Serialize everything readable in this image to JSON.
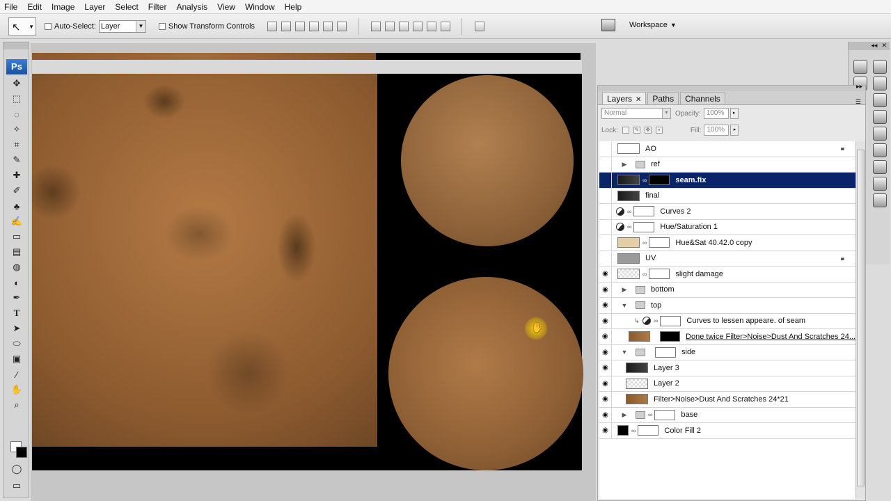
{
  "menu": [
    "File",
    "Edit",
    "Image",
    "Layer",
    "Select",
    "Filter",
    "Analysis",
    "View",
    "Window",
    "Help"
  ],
  "options": {
    "auto_select_label": "Auto-Select:",
    "auto_select_value": "Layer",
    "show_transform_label": "Show Transform Controls",
    "workspace_label": "Workspace"
  },
  "tools": {
    "logo": "Ps"
  },
  "layers_panel": {
    "tabs": [
      "Layers",
      "Paths",
      "Channels"
    ],
    "blend_mode": "Normal",
    "opacity_label": "Opacity:",
    "opacity_value": "100%",
    "lock_label": "Lock:",
    "fill_label": "Fill:",
    "fill_value": "100%",
    "layers": [
      {
        "name": "AO",
        "visible": false,
        "locked": true
      },
      {
        "name": "ref",
        "visible": false,
        "type": "group"
      },
      {
        "name": "seam.fix",
        "visible": false,
        "selected": true
      },
      {
        "name": "final",
        "visible": false
      },
      {
        "name": "Curves 2",
        "visible": false,
        "type": "adjustment"
      },
      {
        "name": "Hue/Saturation 1",
        "visible": false,
        "type": "adjustment"
      },
      {
        "name": "Hue&Sat 40.42.0 copy",
        "visible": false
      },
      {
        "name": "UV",
        "visible": false,
        "locked": true
      },
      {
        "name": "slight damage",
        "visible": true
      },
      {
        "name": "bottom",
        "visible": true,
        "type": "group"
      },
      {
        "name": "top",
        "visible": true,
        "type": "group"
      },
      {
        "name": "Curves to lessen appeare. of seam",
        "visible": true,
        "type": "adjustment"
      },
      {
        "name": "Done twice Filter>Noise>Dust And Scratches 24...",
        "visible": true
      },
      {
        "name": "side",
        "visible": true,
        "type": "group"
      },
      {
        "name": "Layer 3",
        "visible": true
      },
      {
        "name": "Layer 2",
        "visible": true
      },
      {
        "name": "Filter>Noise>Dust And Scratches 24*21",
        "visible": true
      },
      {
        "name": "base",
        "visible": true,
        "type": "group"
      },
      {
        "name": "Color Fill 2",
        "visible": true
      }
    ]
  },
  "colors": {
    "selection": "#0a246a",
    "accent": "#1c4ea2"
  }
}
